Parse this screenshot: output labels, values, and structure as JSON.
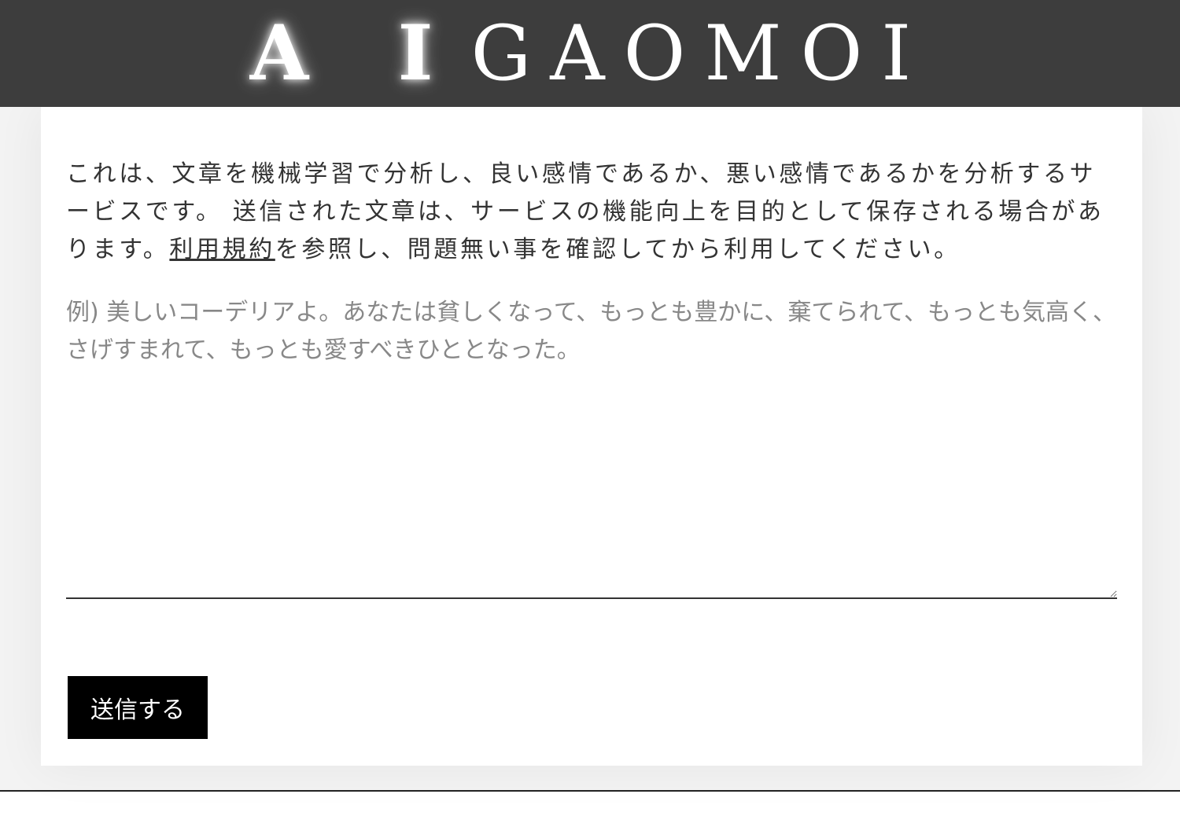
{
  "header": {
    "logo_ai": "A I",
    "logo_rest": "GAOMOI"
  },
  "intro": {
    "text_before_link": "これは、文章を機械学習で分析し、良い感情であるか、悪い感情であるかを分析するサービスです。 送信された文章は、サービスの機能向上を目的として保存される場合があります。",
    "link_label": "利用規約",
    "text_after_link": "を参照し、問題無い事を確認してから利用してください。"
  },
  "form": {
    "input_value": "",
    "placeholder": "例) 美しいコーデリアよ。あなたは貧しくなって、もっとも豊かに、棄てられて、もっとも気高く、さげすまれて、もっとも愛すべきひととなった。",
    "submit_label": "送信する"
  },
  "colors": {
    "header_bg": "#3d3d3d",
    "button_bg": "#000000",
    "text": "#333333",
    "placeholder": "#888888"
  }
}
